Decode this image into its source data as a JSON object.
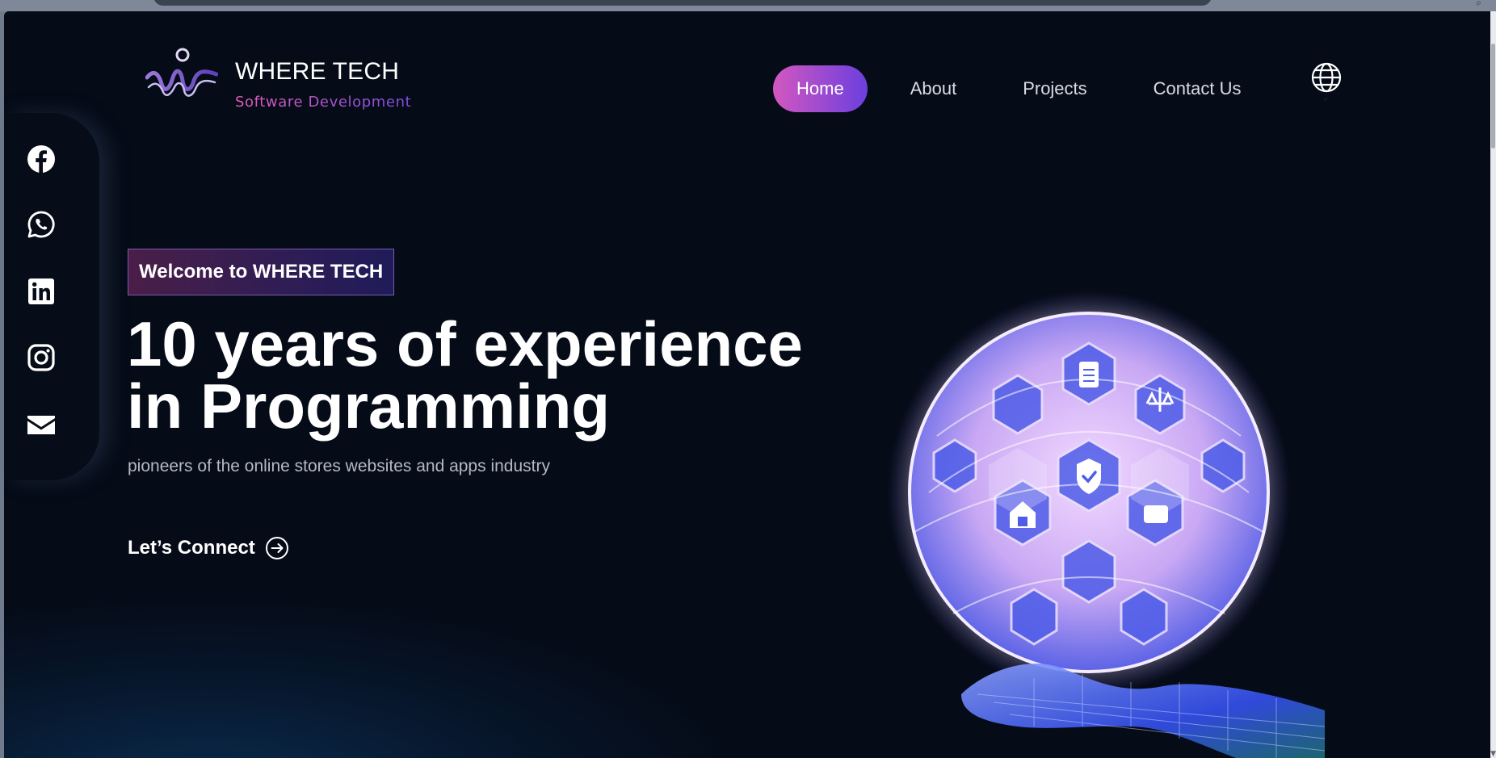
{
  "brand": {
    "title": "WHERE TECH",
    "subtitle": "Software Development",
    "logo_icon": "figure-wave-logo"
  },
  "nav": {
    "items": [
      {
        "label": "Home",
        "active": true
      },
      {
        "label": "About",
        "active": false
      },
      {
        "label": "Projects",
        "active": false
      },
      {
        "label": "Contact Us",
        "active": false
      }
    ],
    "language_icon": "globe-icon"
  },
  "social": [
    "facebook-icon",
    "whatsapp-icon",
    "linkedin-icon",
    "instagram-icon",
    "mail-icon"
  ],
  "hero": {
    "badge": "Welcome to WHERE TECH",
    "headline_line1": "10 years of experience",
    "headline_line2": "in Programming",
    "subtext": "pioneers of the online stores websites and apps industry",
    "cta": "Let’s Connect",
    "cta_icon": "arrow-circle-right-icon"
  },
  "colors": {
    "background": "#050b17",
    "accent_start": "#d357c0",
    "accent_end": "#6b3fde",
    "text": "#ffffff"
  }
}
